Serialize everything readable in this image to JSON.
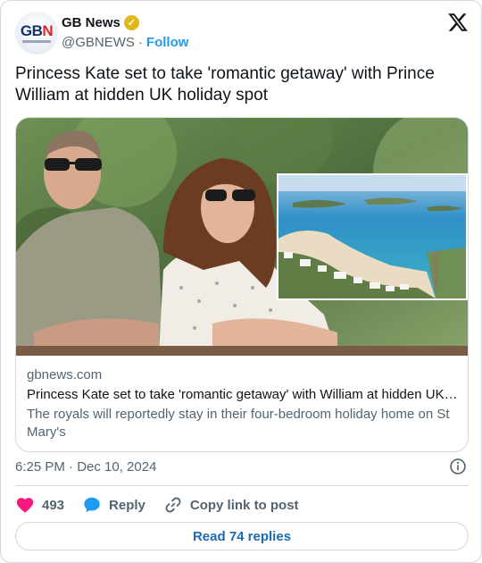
{
  "author": {
    "name": "GB News",
    "handle": "@GBNEWS",
    "follow_label": "Follow",
    "avatar_text_a": "GB",
    "avatar_text_b": "N",
    "verified_badge": "gold-check"
  },
  "tweet": {
    "text": "Princess Kate set to take 'romantic getaway' with Prince William at hidden UK holiday spot"
  },
  "link_card": {
    "domain": "gbnews.com",
    "title": "Princess Kate set to take 'romantic getaway' with William at hidden UK …",
    "description": "The royals will reportedly stay in their four-bedroom holiday home on St Mary's"
  },
  "meta": {
    "timestamp": "6:25 PM · Dec 10, 2024"
  },
  "actions": {
    "like_count": "493",
    "reply_label": "Reply",
    "copy_label": "Copy link to post"
  },
  "footer": {
    "read_replies_label": "Read 74 replies"
  },
  "colors": {
    "accent": "#1d9bf0",
    "like": "#f91880",
    "muted": "#536471",
    "border": "#cfd9de"
  }
}
